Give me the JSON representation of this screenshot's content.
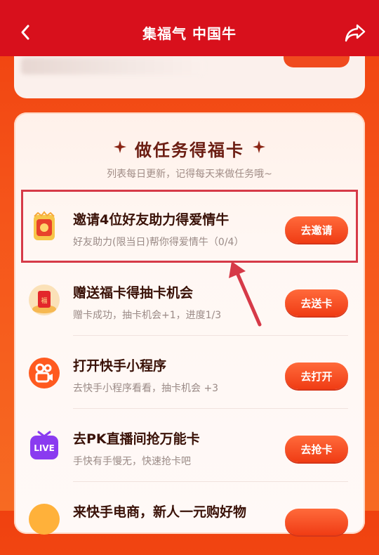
{
  "header": {
    "title": "集福气 中国牛",
    "back_icon": "chevron-left-icon",
    "share_icon": "share-icon"
  },
  "tasks_card": {
    "heading": "做任务得福卡",
    "subheading": "列表每日更新，记得每天来做任务哦~",
    "items": [
      {
        "name": "邀请4位好友助力得爱情牛",
        "desc": "好友助力(限当日)帮你得爱情牛（0/4）",
        "button": "去邀请",
        "icon": "love-cow-card-icon",
        "highlighted": true
      },
      {
        "name": "赠送福卡得抽卡机会",
        "desc": "赠卡成功，抽卡机会+1，进度1/3",
        "button": "去送卡",
        "icon": "fu-card-icon"
      },
      {
        "name": "打开快手小程序",
        "desc": "去快手小程序看看，抽卡机会 +3",
        "button": "去打开",
        "icon": "kuaishou-logo-icon"
      },
      {
        "name": "去PK直播间抢万能卡",
        "desc": "手快有手慢无，快速抢卡吧",
        "button": "去抢卡",
        "icon": "live-icon",
        "icon_text": "LIVE"
      },
      {
        "name": "来快手电商，新人一元购好物",
        "icon": "shop-icon"
      }
    ]
  },
  "colors": {
    "header_bg": "#d8101c",
    "page_bg": "#f5541a",
    "button": "#f03c14",
    "highlight_border": "#d63a48"
  }
}
